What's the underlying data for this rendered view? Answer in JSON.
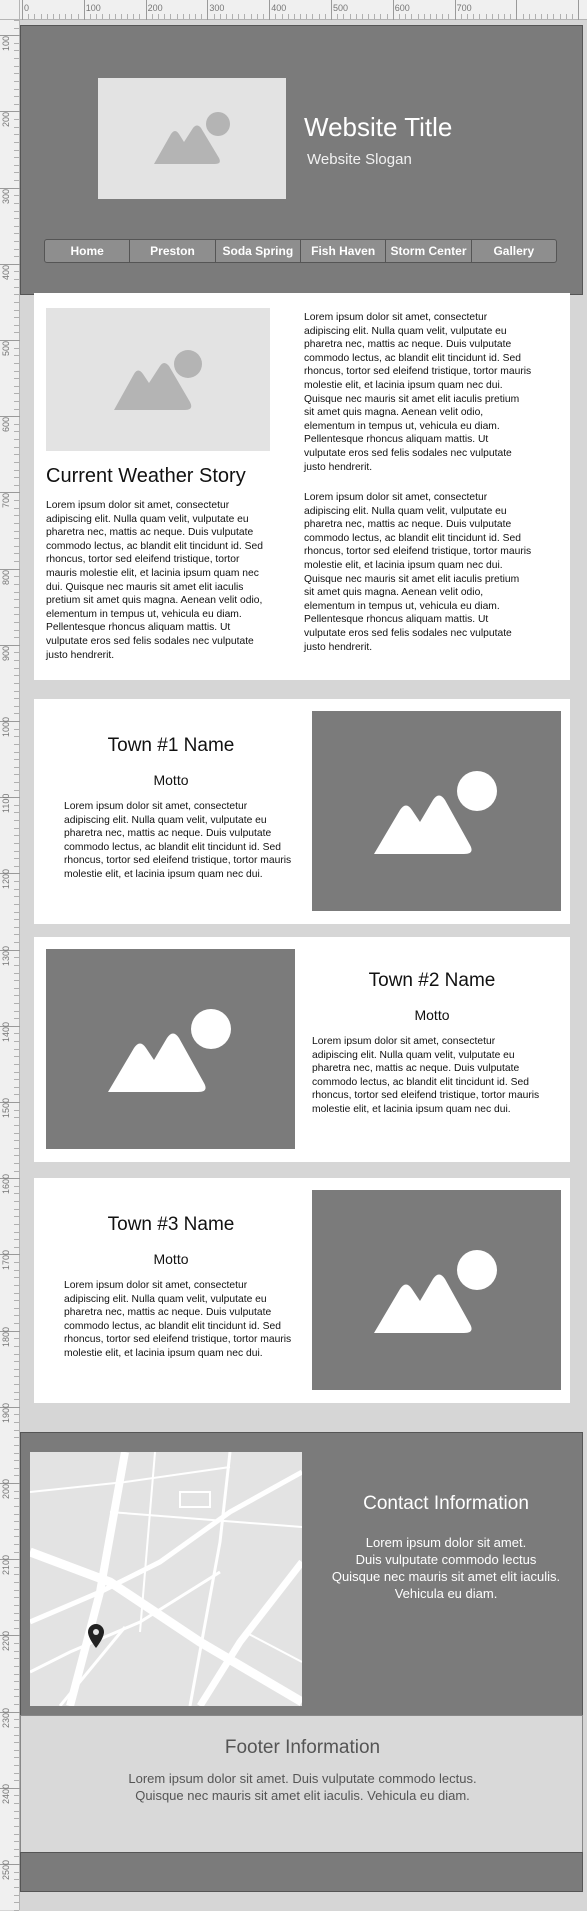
{
  "ruler": {
    "top_labels": [
      "0",
      "100",
      "200",
      "300",
      "400",
      "500",
      "600",
      "700"
    ],
    "left_labels": [
      "100",
      "200",
      "300",
      "400",
      "500",
      "600",
      "700",
      "800",
      "900",
      "1000",
      "1100",
      "1200",
      "1300",
      "1400",
      "1500",
      "1600",
      "1700",
      "1800",
      "1900",
      "2000",
      "2100",
      "2200",
      "2300",
      "2400",
      "2500"
    ]
  },
  "header": {
    "title": "Website Title",
    "slogan": "Website Slogan",
    "hero_icon": "image-placeholder-icon"
  },
  "nav": {
    "items": [
      "Home",
      "Preston",
      "Soda Spring",
      "Fish Haven",
      "Storm Center",
      "Gallery"
    ]
  },
  "weather": {
    "heading": "Current Weather Story",
    "left_text": "Lorem ipsum dolor sit amet, consectetur adipiscing elit. Nulla quam velit, vulputate eu pharetra nec, mattis ac neque. Duis vulputate commodo lectus, ac blandit elit tincidunt id. Sed rhoncus, tortor sed eleifend tristique, tortor mauris molestie elit, et lacinia ipsum quam nec dui. Quisque nec mauris sit amet elit iaculis pretium sit amet quis magna. Aenean velit odio, elementum in tempus ut, vehicula eu diam. Pellentesque rhoncus aliquam mattis. Ut vulputate eros sed felis sodales nec vulputate justo hendrerit.",
    "right_text_1": "Lorem ipsum dolor sit amet, consectetur adipiscing elit. Nulla quam velit, vulputate eu pharetra nec, mattis ac neque. Duis vulputate commodo lectus, ac blandit elit tincidunt id. Sed rhoncus, tortor sed eleifend tristique, tortor mauris molestie elit, et lacinia ipsum quam nec dui. Quisque nec mauris sit amet elit iaculis pretium sit amet quis magna. Aenean velit odio, elementum in tempus ut, vehicula eu diam. Pellentesque rhoncus aliquam mattis. Ut vulputate eros sed felis sodales nec vulputate justo hendrerit.",
    "right_text_2": "Lorem ipsum dolor sit amet, consectetur adipiscing elit. Nulla quam velit, vulputate eu pharetra nec, mattis ac neque. Duis vulputate commodo lectus, ac blandit elit tincidunt id. Sed rhoncus, tortor sed eleifend tristique, tortor mauris molestie elit, et lacinia ipsum quam nec dui. Quisque nec mauris sit amet elit iaculis pretium sit amet quis magna. Aenean velit odio, elementum in tempus ut, vehicula eu diam. Pellentesque rhoncus aliquam mattis. Ut vulputate eros sed felis sodales nec vulputate justo hendrerit."
  },
  "towns": [
    {
      "name": "Town #1 Name",
      "motto": "Motto",
      "text": "Lorem ipsum dolor sit amet, consectetur adipiscing elit. Nulla quam velit, vulputate eu pharetra nec, mattis ac neque. Duis vulputate commodo lectus, ac blandit elit tincidunt id. Sed rhoncus, tortor sed eleifend tristique, tortor mauris molestie elit, et lacinia ipsum quam nec dui."
    },
    {
      "name": "Town #2 Name",
      "motto": "Motto",
      "text": "Lorem ipsum dolor sit amet, consectetur adipiscing elit. Nulla quam velit, vulputate eu pharetra nec, mattis ac neque. Duis vulputate commodo lectus, ac blandit elit tincidunt id. Sed rhoncus, tortor sed eleifend tristique, tortor mauris molestie elit, et lacinia ipsum quam nec dui."
    },
    {
      "name": "Town #3 Name",
      "motto": "Motto",
      "text": "Lorem ipsum dolor sit amet, consectetur adipiscing elit. Nulla quam velit, vulputate eu pharetra nec, mattis ac neque. Duis vulputate commodo lectus, ac blandit elit tincidunt id. Sed rhoncus, tortor sed eleifend tristique, tortor mauris molestie elit, et lacinia ipsum quam nec dui."
    }
  ],
  "contact": {
    "heading": "Contact Information",
    "lines": [
      "Lorem ipsum dolor sit amet.",
      "Duis vulputate commodo lectus",
      "Quisque nec mauris sit amet elit iaculis.",
      "Vehicula eu diam."
    ],
    "map_icon": "map-pin-icon"
  },
  "footer": {
    "heading": "Footer Information",
    "line1": "Lorem ipsum dolor sit amet. Duis vulputate commodo lectus.",
    "line2": "Quisque nec mauris sit amet elit iaculis. Vehicula eu diam."
  },
  "colors": {
    "dark_gray": "#7b7b7b",
    "light_gray": "#e3e3e3",
    "page_bg": "#d6d6d6"
  }
}
